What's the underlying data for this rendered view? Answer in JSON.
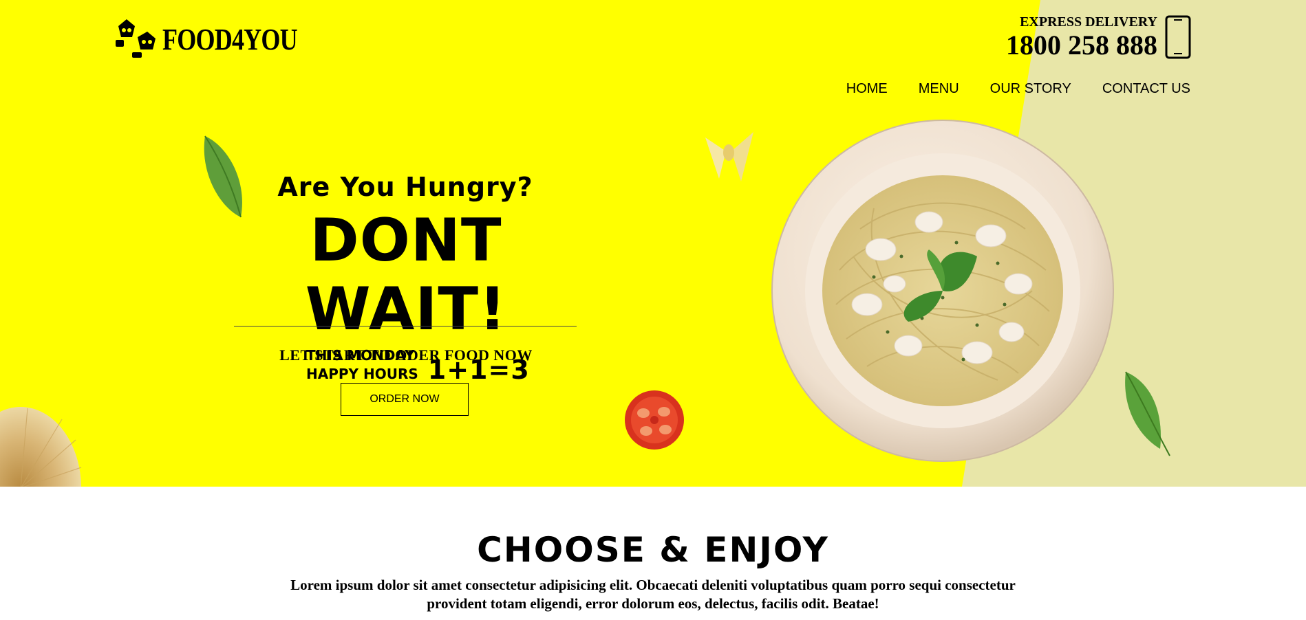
{
  "brand": {
    "name": "FOOD4YOU",
    "logo_icon": "chef-duo-logo-icon"
  },
  "contact": {
    "label": "EXPRESS DELIVERY",
    "phone": "1800 258 888",
    "icon": "smartphone-icon"
  },
  "nav": {
    "items": [
      {
        "label": "HOME"
      },
      {
        "label": "MENU"
      },
      {
        "label": "OUR STORY"
      },
      {
        "label": "CONTACT US"
      }
    ]
  },
  "hero": {
    "question": "Are You Hungry?",
    "headline": "DONT WAIT!",
    "subline": "LET START TO ODER FOOD NOW",
    "promo_line1": "THIS MONDAY",
    "promo_line2": "HAPPY HOURS",
    "promo_deal": "1+1=3",
    "order_button": "ORDER NOW",
    "images": [
      "pasta-plate-image",
      "basil-leaf-image",
      "farfalle-image",
      "tomato-slice-image",
      "spaghetti-bundle-image"
    ]
  },
  "section": {
    "title": "CHOOSE & ENJOY",
    "text": "Lorem ipsum dolor sit amet consectetur adipisicing elit. Obcaecati deleniti voluptatibus quam porro sequi consectetur provident totam eligendi, error dolorum eos, delectus, facilis odit. Beatae!"
  },
  "colors": {
    "hero_background": "#ffff00",
    "hero_side_panel": "#e8e6a8",
    "page_background": "#ffffff",
    "text": "#000000"
  }
}
